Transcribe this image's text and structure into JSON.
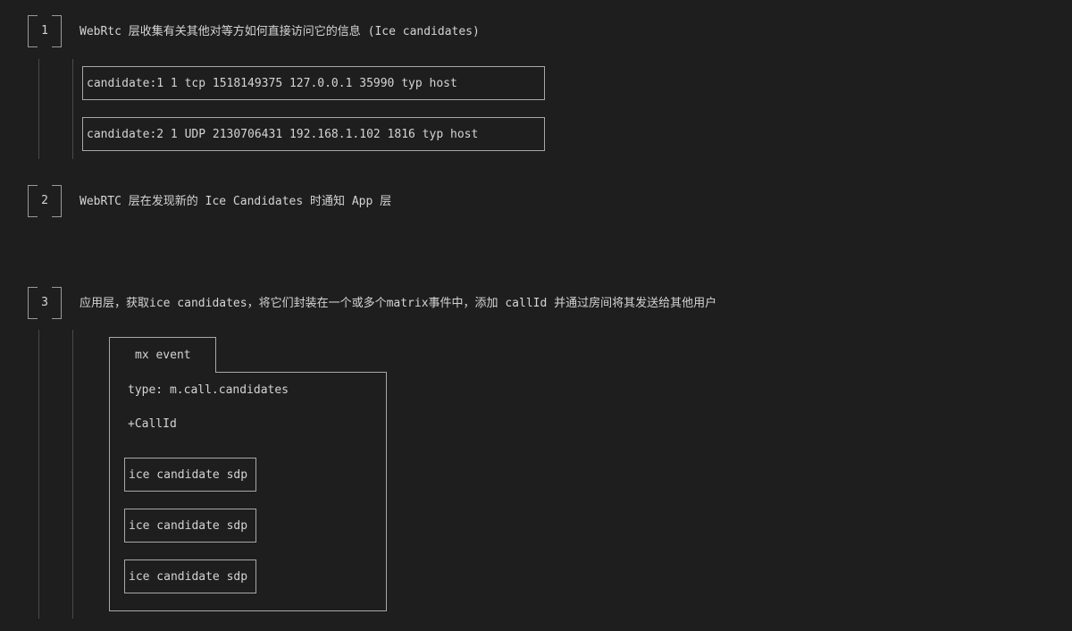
{
  "steps": [
    {
      "number": "1",
      "text": "WebRtc 层收集有关其他对等方如何直接访问它的信息 (Ice candidates)",
      "candidates": [
        "candidate:1 1 tcp 1518149375 127.0.0.1 35990 typ host",
        "candidate:2 1 UDP 2130706431 192.168.1.102 1816 typ host"
      ]
    },
    {
      "number": "2",
      "text": "WebRTC 层在发现新的 Ice Candidates 时通知 App 层"
    },
    {
      "number": "3",
      "text": "应用层，获取ice candidates，将它们封装在一个或多个matrix事件中，添加 callId 并通过房间将其发送给其他用户",
      "event": {
        "tab_label": "mx event",
        "type_line": "type: m.call.candidates",
        "call_id_line": "+CallId",
        "sdp_items": [
          "ice candidate sdp",
          "ice candidate sdp",
          "ice candidate sdp"
        ]
      }
    }
  ]
}
